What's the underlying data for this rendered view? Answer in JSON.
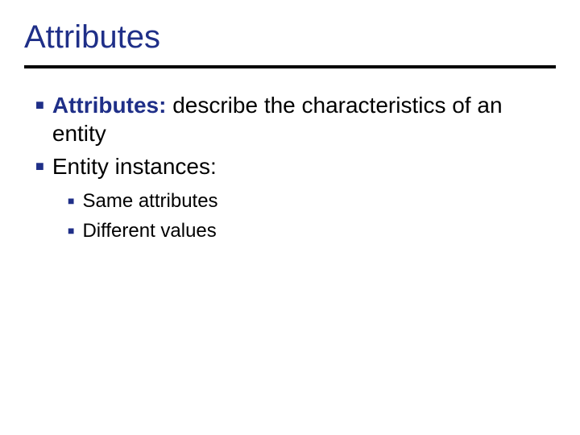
{
  "title": "Attributes",
  "bullets": [
    {
      "bold_lead": "Attributes:",
      "rest": " describe the characteristics of an entity"
    },
    {
      "bold_lead": "",
      "rest": "Entity instances:"
    }
  ],
  "sub_bullets": [
    "Same attributes",
    "Different values"
  ]
}
